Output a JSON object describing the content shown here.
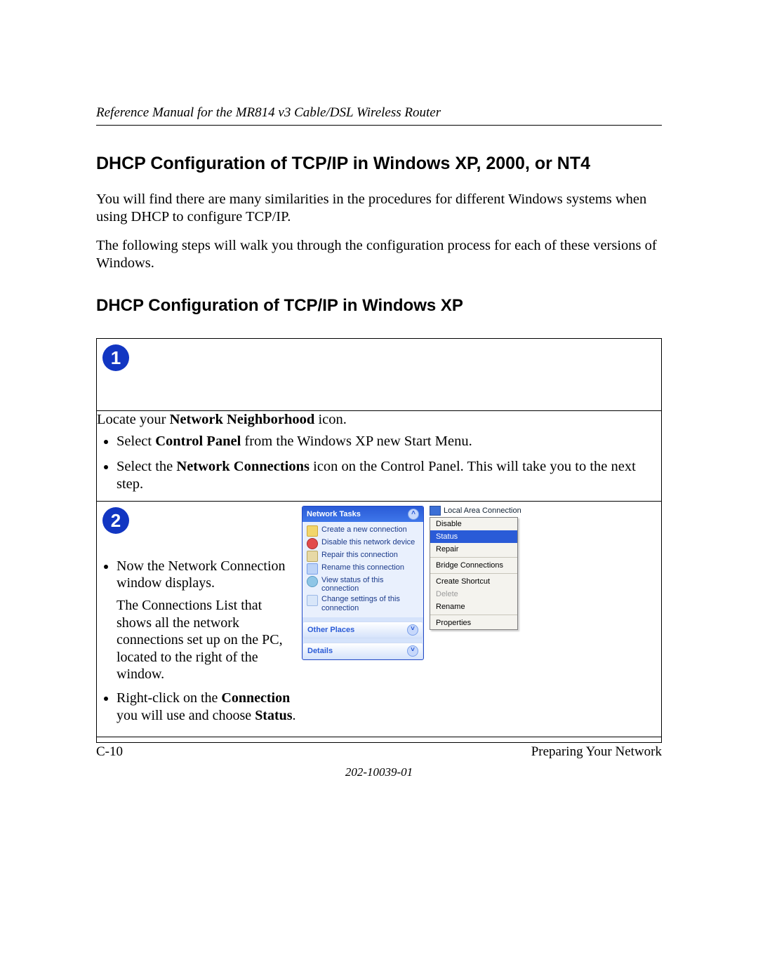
{
  "header": {
    "running": "Reference Manual for the MR814 v3 Cable/DSL Wireless Router"
  },
  "h1": "DHCP Configuration of TCP/IP in Windows XP, 2000, or NT4",
  "p1": "You will find there are many similarities in the procedures for different Windows systems when using DHCP to configure TCP/IP.",
  "p2": "The following steps will walk you through the configuration process for each of these versions of Windows.",
  "h2": "DHCP Configuration of TCP/IP in Windows XP",
  "step1": {
    "num": "1",
    "intro_a": "Locate your ",
    "intro_bold": "Network Neighborhood",
    "intro_b": " icon.",
    "b1_a": "Select ",
    "b1_bold": "Control Panel",
    "b1_b": " from the Windows XP new Start Menu.",
    "b2_a": "Select the ",
    "b2_bold": "Network Connections",
    "b2_b": " icon on the Control Panel.  This will take you to the next step."
  },
  "step2": {
    "num": "2",
    "l1": "Now the Network Connection window displays.",
    "l2": "The Connections List that shows all the network connections set up on the PC, located to the right of the window.",
    "l3_a": "Right-click on the ",
    "l3_bold1": "Connection",
    "l3_b": " you will use and choose ",
    "l3_bold2": "Status",
    "l3_c": "."
  },
  "xp": {
    "networkTasks": "Network Tasks",
    "t1": "Create a new connection",
    "t2": "Disable this network device",
    "t3": "Repair this connection",
    "t4": "Rename this connection",
    "t5": "View status of this connection",
    "t6": "Change settings of this connection",
    "other": "Other Places",
    "details": "Details",
    "lan": "Local Area Connection",
    "menu": {
      "disable": "Disable",
      "status": "Status",
      "repair": "Repair",
      "bridge": "Bridge Connections",
      "shortcut": "Create Shortcut",
      "delete": "Delete",
      "rename": "Rename",
      "props": "Properties"
    }
  },
  "footer": {
    "left": "C-10",
    "right": "Preparing Your Network",
    "docnum": "202-10039-01"
  }
}
